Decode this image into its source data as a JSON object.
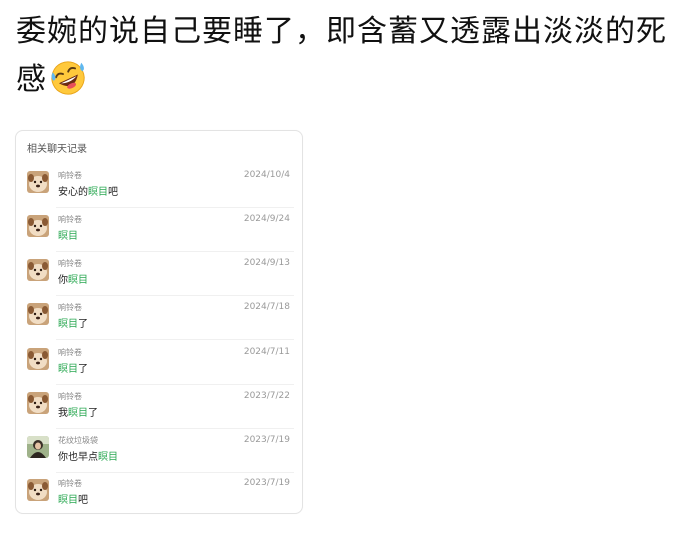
{
  "post": {
    "text": "委婉的说自己要睡了，即含蓄又透露出淡淡的死感"
  },
  "emoji_icon": "rolling-on-floor-laughing-emoji",
  "card": {
    "title": "相关聊天记录",
    "highlight_color": "#2aa852",
    "messages": [
      {
        "sender": "响铃卷",
        "date": "2024/10/4",
        "pre": "安心的",
        "hl": "瞑目",
        "post": "吧",
        "avatar": "dog"
      },
      {
        "sender": "响铃卷",
        "date": "2024/9/24",
        "pre": "",
        "hl": "瞑目",
        "post": "",
        "avatar": "dog"
      },
      {
        "sender": "响铃卷",
        "date": "2024/9/13",
        "pre": "你",
        "hl": "瞑目",
        "post": "",
        "avatar": "dog"
      },
      {
        "sender": "响铃卷",
        "date": "2024/7/18",
        "pre": "",
        "hl": "瞑目",
        "post": "了",
        "avatar": "dog"
      },
      {
        "sender": "响铃卷",
        "date": "2024/7/11",
        "pre": "",
        "hl": "瞑目",
        "post": "了",
        "avatar": "dog"
      },
      {
        "sender": "响铃卷",
        "date": "2023/7/22",
        "pre": "我",
        "hl": "瞑目",
        "post": "了",
        "avatar": "dog"
      },
      {
        "sender": "花纹垃圾袋",
        "date": "2023/7/19",
        "pre": "你也早点",
        "hl": "瞑目",
        "post": "",
        "avatar": "person"
      },
      {
        "sender": "响铃卷",
        "date": "2023/7/19",
        "pre": "",
        "hl": "瞑目",
        "post": "吧",
        "avatar": "dog"
      }
    ]
  }
}
